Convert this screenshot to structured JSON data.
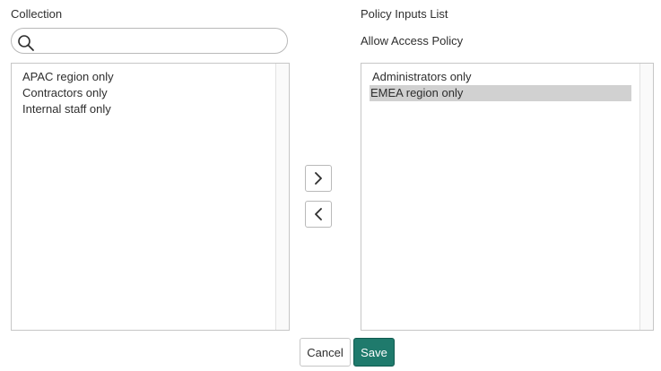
{
  "collection": {
    "label": "Collection",
    "search": {
      "value": "",
      "placeholder": ""
    },
    "items": [
      "APAC region only",
      "Contractors only",
      "Internal staff only"
    ]
  },
  "policy": {
    "list_label": "Policy Inputs List",
    "sublabel": "Allow Access Policy",
    "items": [
      "Administrators only",
      "EMEA region only"
    ],
    "selected_item": "EMEA region only"
  },
  "transfer": {
    "add_icon": "chevron-right-icon",
    "remove_icon": "chevron-left-icon"
  },
  "footer": {
    "cancel_label": "Cancel",
    "save_label": "Save"
  },
  "colors": {
    "save_bg": "#1f7a6c",
    "selection": "#d1d1d1"
  }
}
